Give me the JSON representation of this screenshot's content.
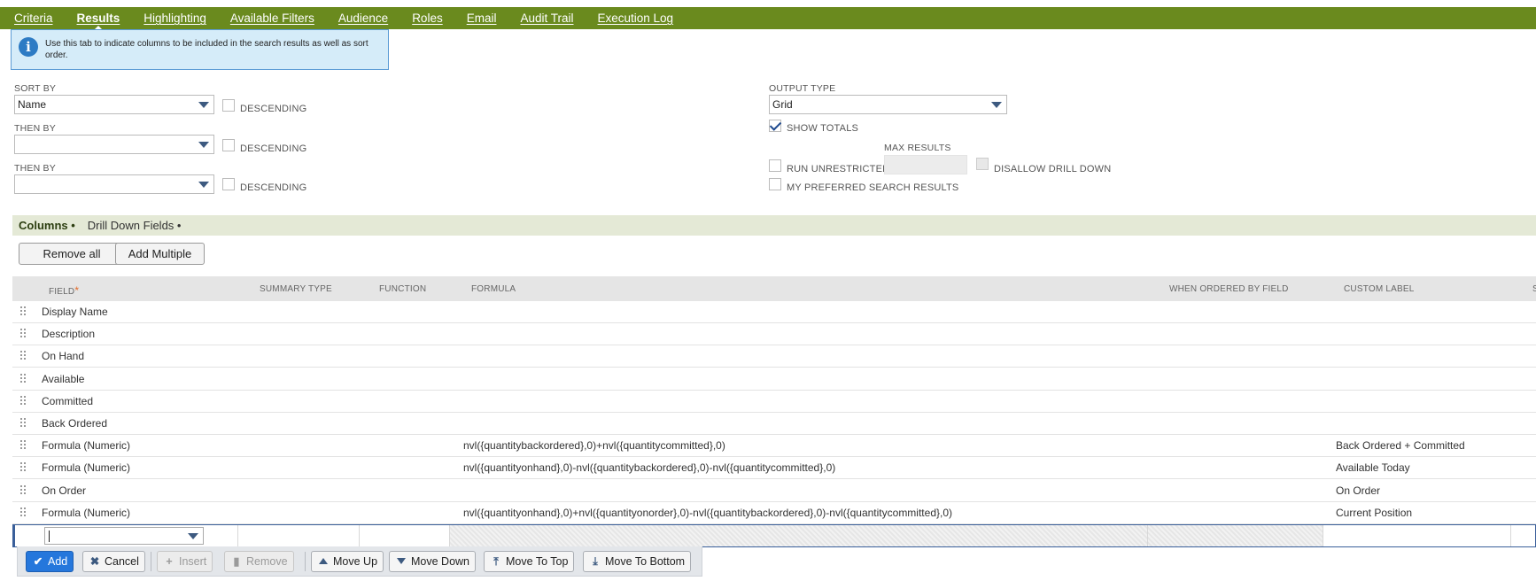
{
  "tabs": [
    {
      "label": "Criteria",
      "active": false
    },
    {
      "label": "Results",
      "active": true
    },
    {
      "label": "Highlighting",
      "active": false
    },
    {
      "label": "Available Filters",
      "active": false
    },
    {
      "label": "Audience",
      "active": false
    },
    {
      "label": "Roles",
      "active": false
    },
    {
      "label": "Email",
      "active": false
    },
    {
      "label": "Audit Trail",
      "active": false
    },
    {
      "label": "Execution Log",
      "active": false
    }
  ],
  "info": {
    "text": "Use this tab to indicate columns to be included in the search results as well as sort order."
  },
  "sort": {
    "sort_by_label": "SORT BY",
    "sort_by_value": "Name",
    "then_by_label": "THEN BY",
    "then_by_value_1": "",
    "then_by_value_2": "",
    "descending_label": "DESCENDING"
  },
  "output": {
    "output_type_label": "OUTPUT TYPE",
    "output_type_value": "Grid",
    "show_totals_label": "SHOW TOTALS",
    "show_totals_checked": true,
    "max_results_label": "MAX RESULTS",
    "run_unrestricted_label": "RUN UNRESTRICTED",
    "disallow_drill_down_label": "DISALLOW DRILL DOWN",
    "preferred_label": "MY PREFERRED SEARCH RESULTS"
  },
  "subtabs": [
    {
      "label": "Columns •",
      "active": true
    },
    {
      "label": "Drill Down Fields •",
      "active": false
    }
  ],
  "buttons": {
    "remove_all": "Remove all",
    "add_multiple": "Add Multiple"
  },
  "grid": {
    "headers": {
      "field": "FIELD",
      "required_mark": "*",
      "summary_type": "SUMMARY TYPE",
      "function": "FUNCTION",
      "formula": "FORMULA",
      "when_ordered": "WHEN ORDERED BY FIELD",
      "custom_label": "CUSTOM LABEL",
      "extra": "S"
    },
    "rows": [
      {
        "field": "Display Name",
        "formula": "",
        "custom_label": ""
      },
      {
        "field": "Description",
        "formula": "",
        "custom_label": ""
      },
      {
        "field": "On Hand",
        "formula": "",
        "custom_label": ""
      },
      {
        "field": "Available",
        "formula": "",
        "custom_label": ""
      },
      {
        "field": "Committed",
        "formula": "",
        "custom_label": ""
      },
      {
        "field": "Back Ordered",
        "formula": "",
        "custom_label": ""
      },
      {
        "field": "Formula (Numeric)",
        "formula": "nvl({quantitybackordered},0)+nvl({quantitycommitted},0)",
        "custom_label": "Back Ordered + Committed"
      },
      {
        "field": "Formula (Numeric)",
        "formula": "nvl({quantityonhand},0)-nvl({quantitybackordered},0)-nvl({quantitycommitted},0)",
        "custom_label": "Available Today"
      },
      {
        "field": "On Order",
        "formula": "",
        "custom_label": "On Order"
      },
      {
        "field": "Formula (Numeric)",
        "formula": "nvl({quantityonhand},0)+nvl({quantityonorder},0)-nvl({quantitybackordered},0)-nvl({quantitycommitted},0)",
        "custom_label": "Current Position"
      }
    ]
  },
  "actions": {
    "add": "Add",
    "cancel": "Cancel",
    "insert": "Insert",
    "remove": "Remove",
    "move_up": "Move Up",
    "move_down": "Move Down",
    "move_to_top": "Move To Top",
    "move_to_bottom": "Move To Bottom"
  },
  "colors": {
    "tabbar": "#6a8a1e",
    "info_bg": "#d5ecf9",
    "subtab_bg": "#e4e9d6",
    "primary": "#2577dc"
  }
}
